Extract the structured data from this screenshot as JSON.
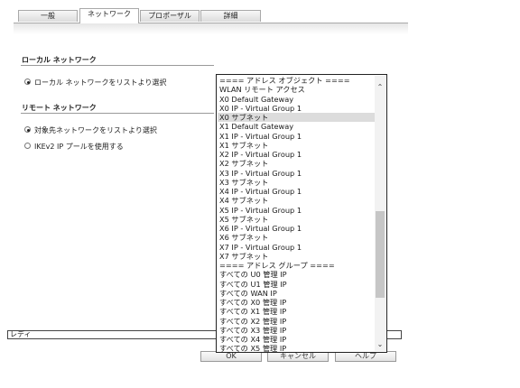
{
  "tabs": [
    {
      "label": "一般"
    },
    {
      "label": "ネットワーク",
      "active": true
    },
    {
      "label": "プロポーザル"
    },
    {
      "label": "詳細"
    }
  ],
  "local": {
    "title": "ローカル ネットワーク",
    "option": "ローカル ネットワークをリストより選択"
  },
  "remote": {
    "title": "リモート ネットワーク",
    "option_list": "対象先ネットワークをリストより選択",
    "option_ikev2": "IKEv2 IP プールを使用する"
  },
  "status": "レディ",
  "buttons": {
    "ok": "OK",
    "cancel": "キャンセル",
    "help": "ヘルプ"
  },
  "listbox": {
    "selected_index": 4,
    "items": [
      "==== アドレス オブジェクト ====",
      "WLAN リモート アクセス",
      "X0 Default Gateway",
      "X0 IP - Virtual Group 1",
      "X0 サブネット",
      "X1 Default Gateway",
      "X1 IP - Virtual Group 1",
      "X1 サブネット",
      "X2 IP - Virtual Group 1",
      "X2 サブネット",
      "X3 IP - Virtual Group 1",
      "X3 サブネット",
      "X4 IP - Virtual Group 1",
      "X4 サブネット",
      "X5 IP - Virtual Group 1",
      "X5 サブネット",
      "X6 IP - Virtual Group 1",
      "X6 サブネット",
      "X7 IP - Virtual Group 1",
      "X7 サブネット",
      "==== アドレス グループ ====",
      "すべての U0 管理 IP",
      "すべての U1 管理 IP",
      "すべての WAN IP",
      "すべての X0 管理 IP",
      "すべての X1 管理 IP",
      "すべての X2 管理 IP",
      "すべての X3 管理 IP",
      "すべての X4 管理 IP",
      "すべての X5 管理 IP"
    ]
  }
}
